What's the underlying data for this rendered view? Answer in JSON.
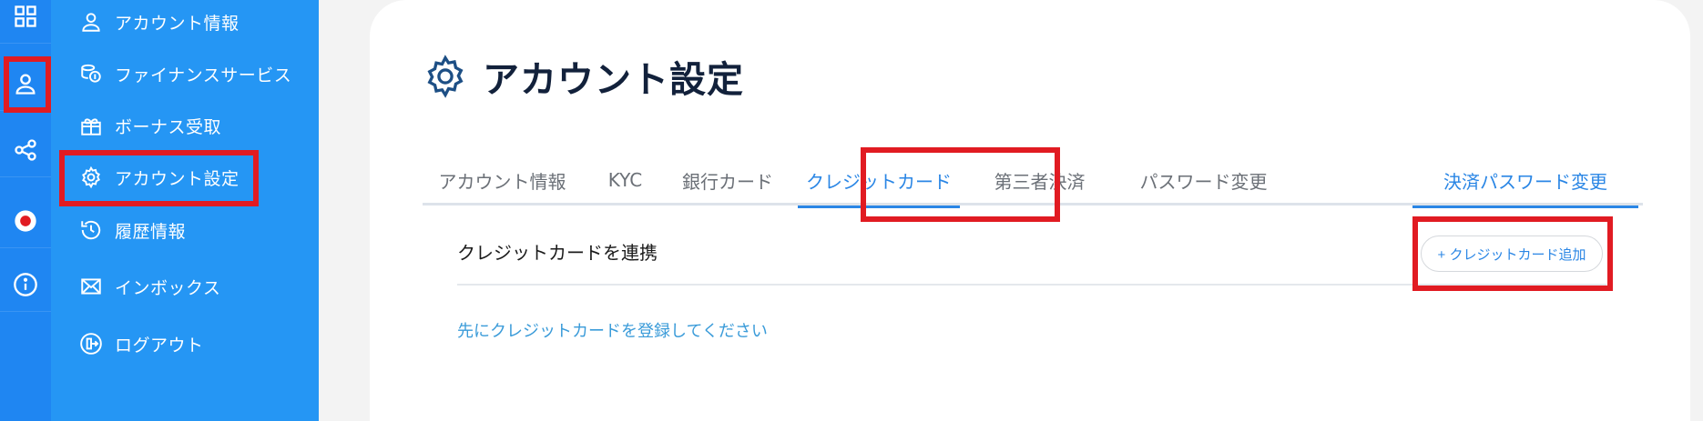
{
  "colors": {
    "rail": "#1f86f2",
    "sidebar": "#2596f4",
    "accent": "#2a86e5",
    "annotation": "#e11b22",
    "title": "#12213b"
  },
  "rail": {
    "items": [
      {
        "icon": "grid-icon"
      },
      {
        "icon": "user-icon"
      },
      {
        "icon": "share-icon"
      },
      {
        "icon": "japan-flag-icon"
      },
      {
        "icon": "info-icon"
      }
    ]
  },
  "sidebar": {
    "items": [
      {
        "label": "アカウント情報",
        "icon": "user-icon"
      },
      {
        "label": "ファイナンスサービス",
        "icon": "coins-icon"
      },
      {
        "label": "ボーナス受取",
        "icon": "gift-icon"
      },
      {
        "label": "アカウント設定",
        "icon": "gear-icon"
      },
      {
        "label": "履歴情報",
        "icon": "history-icon"
      },
      {
        "label": "インボックス",
        "icon": "mail-icon"
      },
      {
        "label": "ログアウト",
        "icon": "logout-icon"
      }
    ]
  },
  "main": {
    "title": "アカウント設定",
    "tabs": [
      {
        "label": "アカウント情報"
      },
      {
        "label": "KYC"
      },
      {
        "label": "銀行カード"
      },
      {
        "label": "クレジットカード"
      },
      {
        "label": "第三者決済"
      },
      {
        "label": "パスワード変更"
      },
      {
        "label": "決済パスワード変更"
      }
    ],
    "active_tab": "クレジットカード",
    "section_label": "クレジットカードを連携",
    "add_button_label": "+ クレジットカード追加",
    "notice": "先にクレジットカードを登録してください"
  }
}
